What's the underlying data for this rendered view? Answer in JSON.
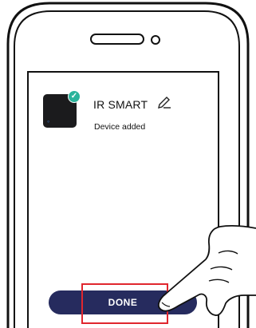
{
  "device": {
    "name": "IR SMART",
    "status": "Device added",
    "badge_icon": "check-icon",
    "edit_icon": "pencil-icon"
  },
  "actions": {
    "done_label": "DONE"
  },
  "colors": {
    "button": "#262b5e",
    "badge": "#2bb39b",
    "highlight": "#e0262e",
    "device_tile": "#1b1b1d"
  }
}
